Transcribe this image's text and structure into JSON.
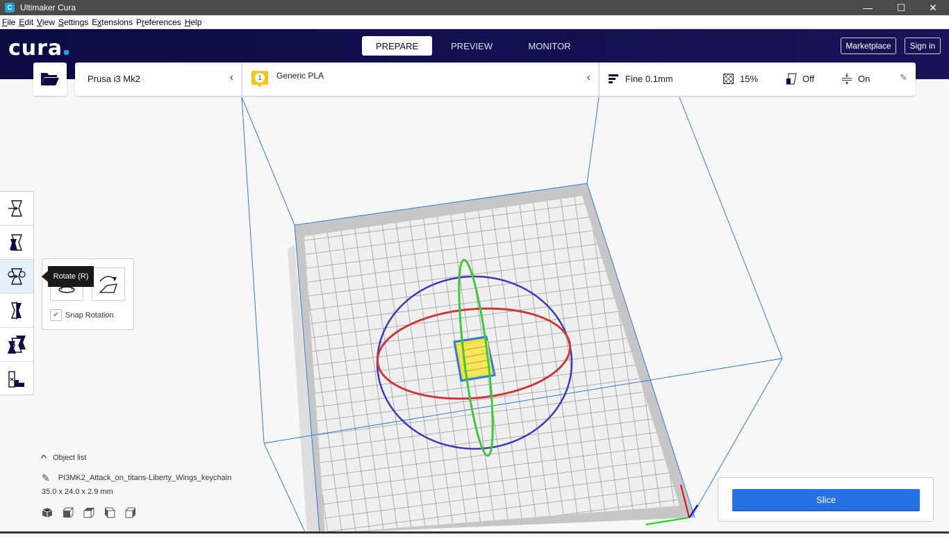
{
  "window": {
    "title": "Ultimaker Cura",
    "app_icon_letter": "C",
    "controls": {
      "minimize": "—",
      "maximize": "☐",
      "close": "✕"
    }
  },
  "menu": [
    {
      "label": "File",
      "mnemonic": "F",
      "rest": "ile"
    },
    {
      "label": "Edit",
      "mnemonic": "E",
      "rest": "dit"
    },
    {
      "label": "View",
      "mnemonic": "V",
      "rest": "iew"
    },
    {
      "label": "Settings",
      "mnemonic": "S",
      "rest": "ettings"
    },
    {
      "label": "Extensions",
      "pre": "E",
      "mnemonic": "x",
      "rest": "tensions"
    },
    {
      "label": "Preferences",
      "pre": "P",
      "mnemonic": "r",
      "rest": "eferences"
    },
    {
      "label": "Help",
      "mnemonic": "H",
      "rest": "elp"
    }
  ],
  "header": {
    "logo": "cura",
    "stages": [
      {
        "label": "PREPARE",
        "active": true
      },
      {
        "label": "PREVIEW",
        "active": false
      },
      {
        "label": "MONITOR",
        "active": false
      }
    ],
    "marketplace_label": "Marketplace",
    "signin_label": "Sign in"
  },
  "printer_bar": {
    "open_file_icon": "folder-open-icon",
    "printer_name": "Prusa i3 Mk2",
    "extruder_number": "1",
    "material": "Generic PLA",
    "profile": "Fine 0.1mm",
    "infill": "15%",
    "support": "Off",
    "adhesion": "On"
  },
  "tools": [
    {
      "name": "move",
      "active": false
    },
    {
      "name": "scale",
      "active": false
    },
    {
      "name": "rotate",
      "active": true
    },
    {
      "name": "mirror",
      "active": false
    },
    {
      "name": "per-model-settings",
      "active": false
    },
    {
      "name": "support-blocker",
      "active": false
    }
  ],
  "rotate_panel": {
    "tooltip": "Rotate (R)",
    "snap_label": "Snap Rotation",
    "snap_checked": true
  },
  "object_list": {
    "toggle_label": "Object list",
    "object_name": "PI3MK2_Attack_on_titans-Liberty_Wings_keychain",
    "dimensions": "35.0 x 24.0 x 2.9 mm"
  },
  "slice": {
    "label": "Slice"
  },
  "colors": {
    "header_bg": "#0b0b44",
    "accent_blue": "#2671e2",
    "rotate_x": "#cc3333",
    "rotate_y": "#33cc33",
    "rotate_z": "#3333bb",
    "model": "#f5e342",
    "volume_edge": "#2a7ae2"
  }
}
